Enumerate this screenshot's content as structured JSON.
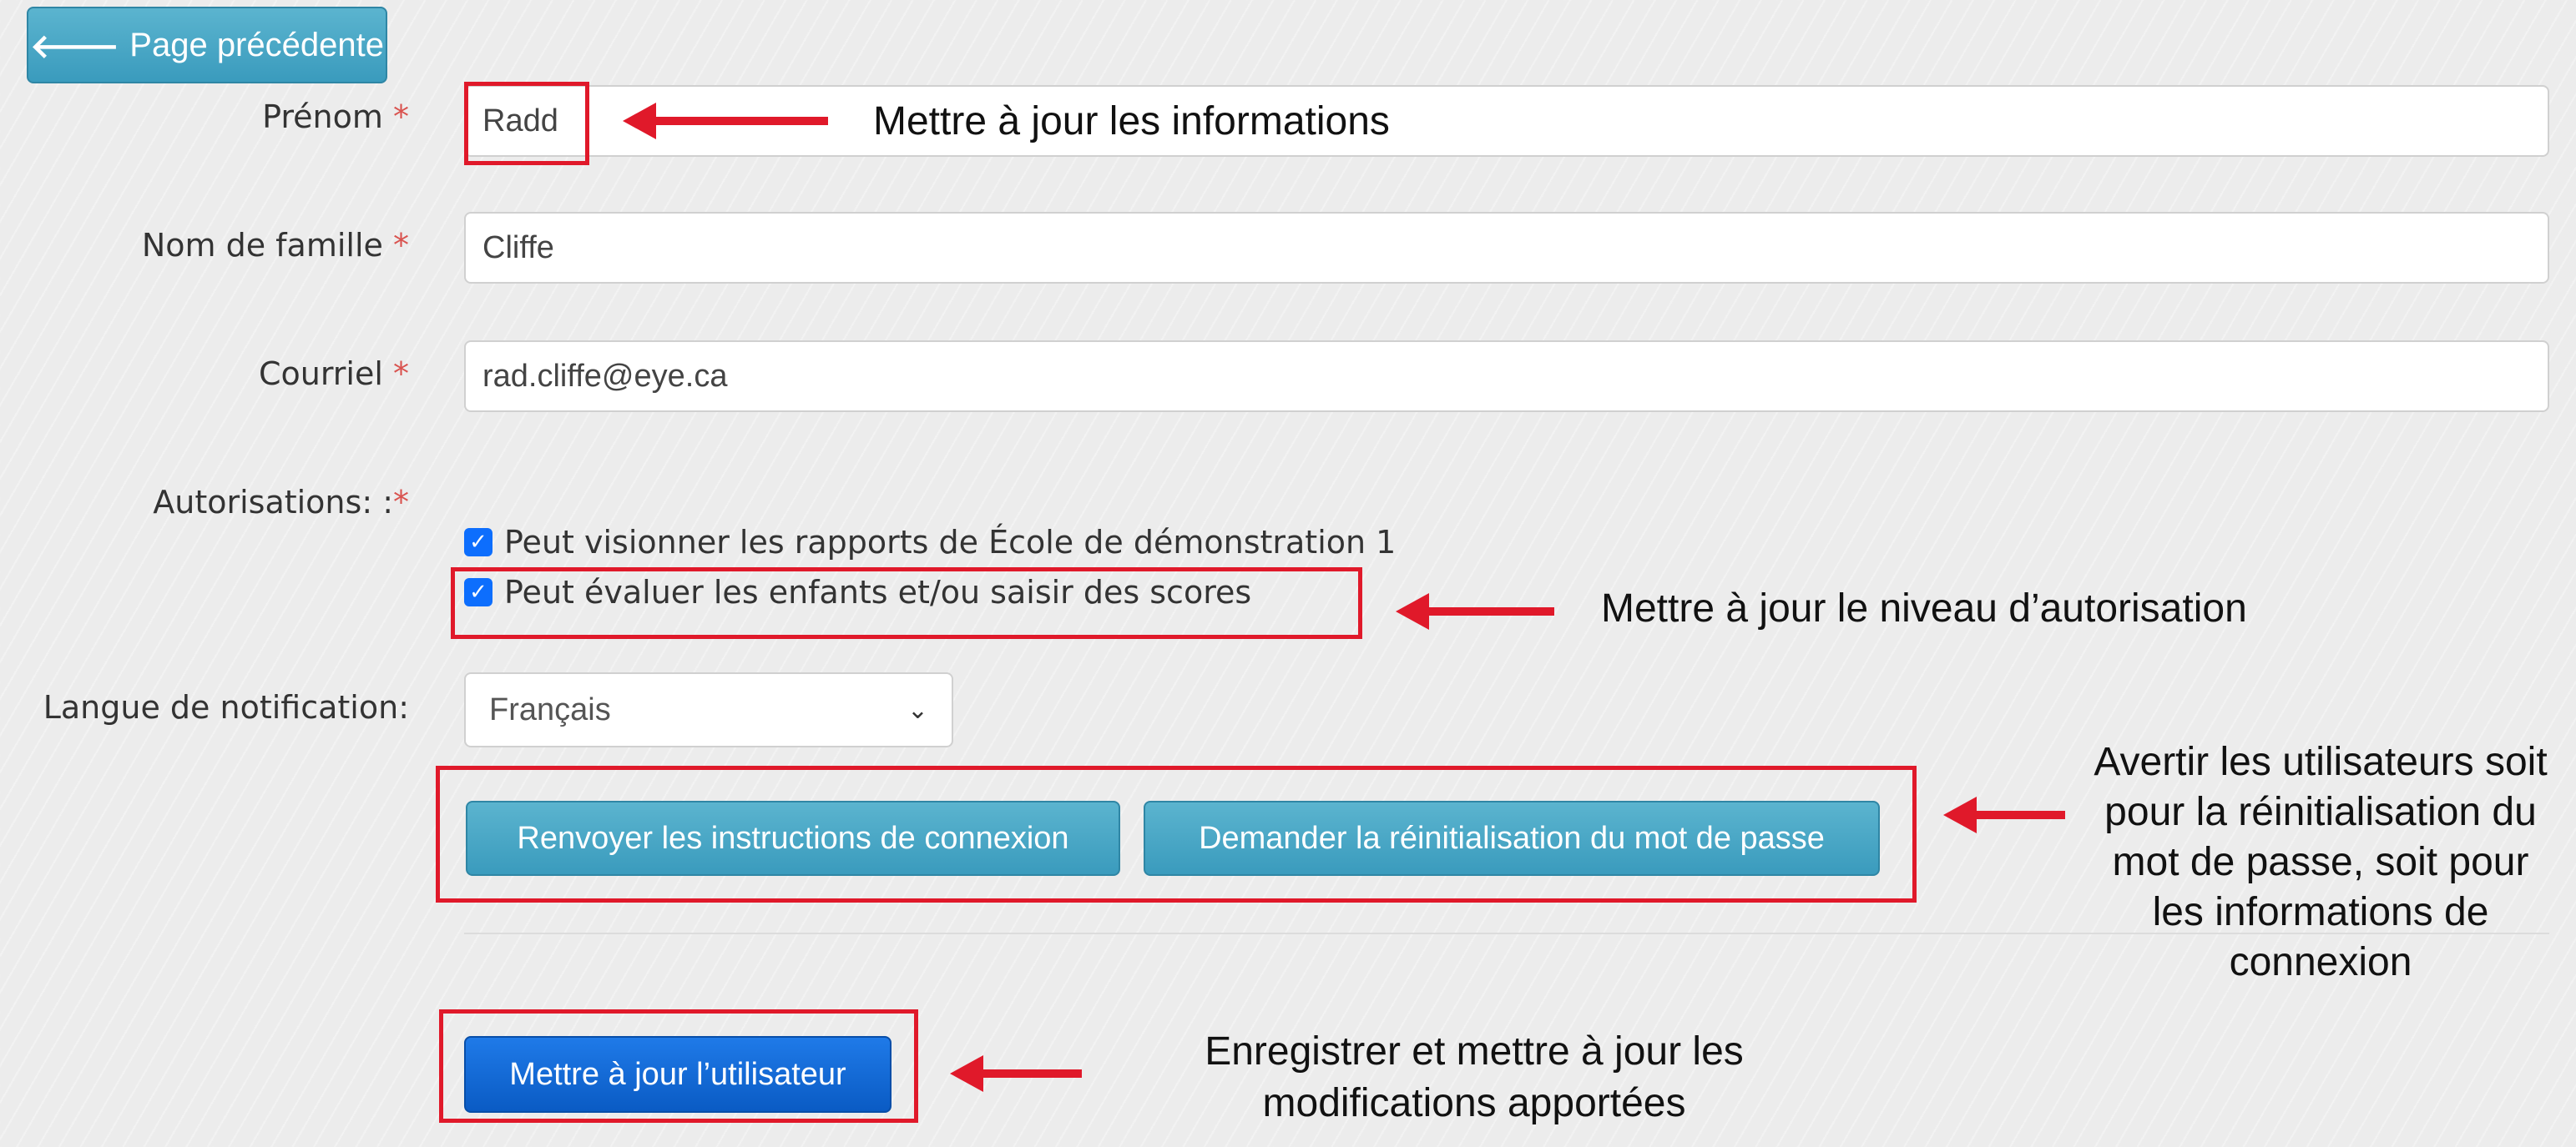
{
  "back_button": {
    "label": "Page précédente"
  },
  "form": {
    "first_name": {
      "label": "Prénom",
      "value": "Radd"
    },
    "last_name": {
      "label": "Nom de famille",
      "value": "Cliffe"
    },
    "email": {
      "label": "Courriel",
      "value": "rad.cliffe@eye.ca"
    },
    "permissions": {
      "label": "Autorisations: :",
      "items": [
        {
          "label": "Peut visionner les rapports de École de démonstration 1",
          "checked": true
        },
        {
          "label": "Peut évaluer les enfants et/ou saisir des scores",
          "checked": true
        }
      ]
    },
    "notification_language": {
      "label": "Langue de notification:",
      "selected": "Français"
    },
    "required_marker": "*"
  },
  "buttons": {
    "resend_instructions": "Renvoyer les instructions de connexion",
    "request_password_reset": "Demander la réinitialisation du mot de passe",
    "update_user": "Mettre à jour l’utilisateur"
  },
  "annotations": {
    "update_info": "Mettre à jour les informations",
    "update_permission": "Mettre à jour le niveau d’autorisation",
    "notify_users": [
      "Avertir les utilisateurs soit",
      "pour la réinitialisation du",
      "mot de passe, soit pour",
      "les informations de",
      "connexion"
    ],
    "save_changes": [
      "Enregistrer et mettre à jour les",
      "modifications apportées"
    ]
  },
  "colors": {
    "annotation_red": "#e0192a",
    "info_button": "#3a9bbd",
    "primary_button": "#0a5bc4",
    "checkbox": "#0d6efd"
  }
}
